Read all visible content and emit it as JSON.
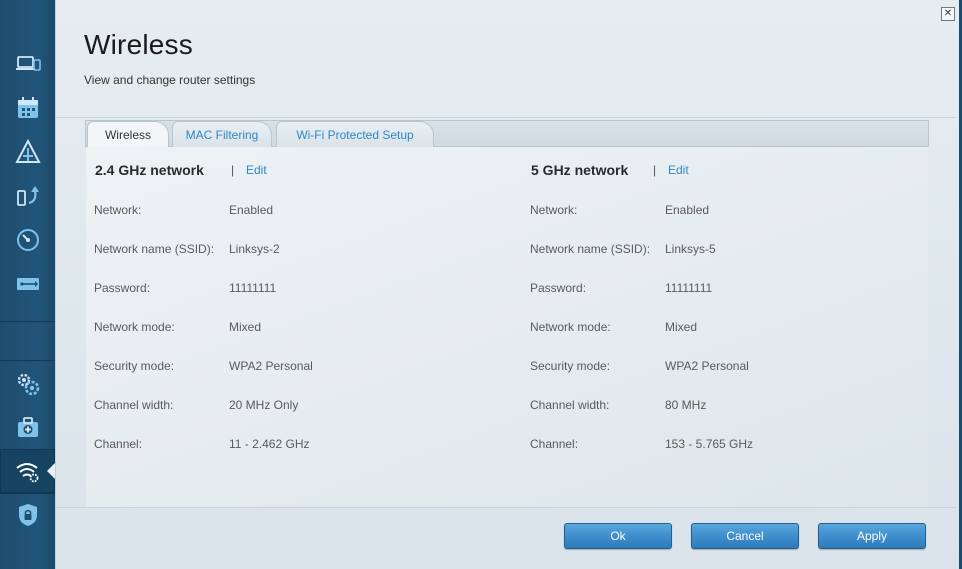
{
  "header": {
    "title": "Wireless",
    "subtitle": "View and change router settings"
  },
  "tabs": [
    {
      "label": "Wireless",
      "active": true
    },
    {
      "label": "MAC Filtering",
      "active": false
    },
    {
      "label": "Wi-Fi Protected Setup",
      "active": false
    }
  ],
  "sidebar": {
    "items": [
      {
        "icon": "devices-icon"
      },
      {
        "icon": "calendar-icon"
      },
      {
        "icon": "network-map-icon"
      },
      {
        "icon": "transfer-icon"
      },
      {
        "icon": "speed-gauge-icon"
      },
      {
        "icon": "usb-storage-icon"
      },
      {
        "icon": "settings-gears-icon"
      },
      {
        "icon": "troubleshooting-kit-icon"
      },
      {
        "icon": "wireless-settings-icon",
        "active": true
      },
      {
        "icon": "security-shield-icon"
      }
    ]
  },
  "band24": {
    "heading": "2.4 GHz network",
    "separator": "|",
    "edit": "Edit",
    "rows": [
      {
        "label": "Network:",
        "value": "Enabled"
      },
      {
        "label": "Network name (SSID):",
        "value": "Linksys-2"
      },
      {
        "label": "Password:",
        "value": "11111111"
      },
      {
        "label": "Network mode:",
        "value": "Mixed"
      },
      {
        "label": "Security mode:",
        "value": "WPA2 Personal"
      },
      {
        "label": "Channel width:",
        "value": "20 MHz Only"
      },
      {
        "label": "Channel:",
        "value": "11 - 2.462 GHz"
      }
    ]
  },
  "band5": {
    "heading": "5 GHz network",
    "separator": "|",
    "edit": "Edit",
    "rows": [
      {
        "label": "Network:",
        "value": "Enabled"
      },
      {
        "label": "Network name (SSID):",
        "value": "Linksys-5"
      },
      {
        "label": "Password:",
        "value": "11111111"
      },
      {
        "label": "Network mode:",
        "value": "Mixed"
      },
      {
        "label": "Security mode:",
        "value": "WPA2 Personal"
      },
      {
        "label": "Channel width:",
        "value": "80 MHz"
      },
      {
        "label": "Channel:",
        "value": "153 - 5.765 GHz"
      }
    ]
  },
  "buttons": {
    "ok": "Ok",
    "cancel": "Cancel",
    "apply": "Apply"
  },
  "colors": {
    "accent_link": "#2f87c5",
    "sidebar_bg": "#215579",
    "button_blue": "#3d8ccc"
  }
}
